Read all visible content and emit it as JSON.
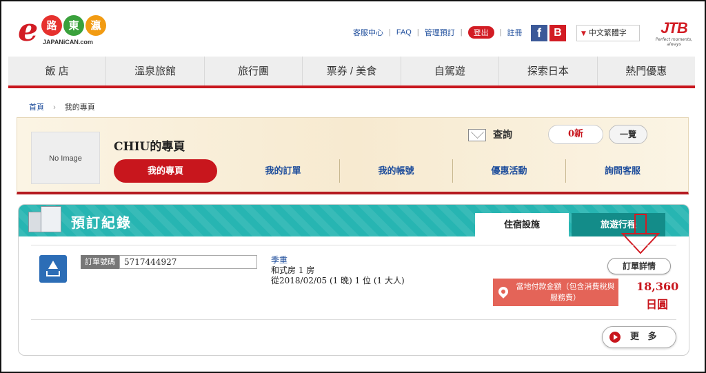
{
  "header": {
    "logo_main": "路東瀛",
    "logo_sub": "JAPANiCAN.com",
    "links": [
      "客服中心",
      "FAQ",
      "管理預訂"
    ],
    "logout": "登出",
    "register": "註冊",
    "language": "中文繁體字",
    "jtb": "JTB",
    "jtb_tagline": "Perfect moments, always"
  },
  "nav": [
    "飯 店",
    "溫泉旅館",
    "旅行團",
    "票券 / 美食",
    "自駕遊",
    "探索日本",
    "熱門優惠"
  ],
  "breadcrumb": {
    "home": "首頁",
    "current": "我的專頁"
  },
  "mypage": {
    "no_image": "No Image",
    "title": "CHIU的專頁",
    "tabs": [
      "我的專頁",
      "我的訂單",
      "我的帳號",
      "優惠活動",
      "詢問客服"
    ],
    "inquiry_label": "查詢",
    "new_count": "0新",
    "list_label": "一覽"
  },
  "booking": {
    "title": "預訂紀錄",
    "tab_lodging": "住宿設施",
    "tab_tour": "旅遊行程",
    "order_label": "訂單號碼",
    "order_number": "5717444927",
    "hotel": "季重",
    "room": "和式房  1 房",
    "dates": "從2018/02/05  (1 晚)  1 位 (1 大人)",
    "detail_button": "訂單詳情",
    "pay_label": "當地付款金額（包含消費稅與服務費）",
    "amount": "18,360",
    "currency": "日圓",
    "more_button": "更 多"
  },
  "colors": {
    "brand_red": "#c8161d",
    "teal": "#27b5b2",
    "link_blue": "#1f4e9c"
  }
}
